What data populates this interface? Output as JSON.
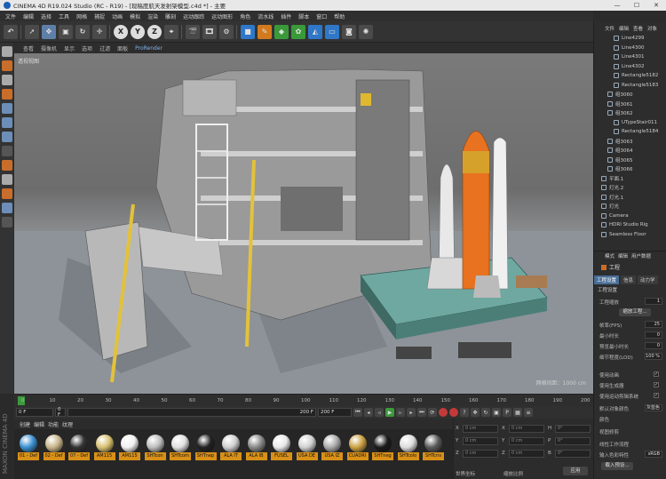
{
  "window": {
    "title": "CINEMA 4D R19.024 Studio (RC - R19) - [现稿度航天发射架模型.c4d *] - 主要",
    "controls": [
      "—",
      "☐",
      "✕"
    ]
  },
  "menu": [
    "文件",
    "编辑",
    "选择",
    "工具",
    "网格",
    "捕捉",
    "动画",
    "模拟",
    "渲染",
    "雕刻",
    "运动跟踪",
    "运动图形",
    "角色",
    "流水线",
    "插件",
    "脚本",
    "窗口",
    "帮助"
  ],
  "toolbar": {
    "axis_buttons": [
      "X",
      "Y",
      "Z"
    ]
  },
  "viewport_menu": [
    "查看",
    "摄像机",
    "显示",
    "选项",
    "过滤",
    "面板",
    "ProRender"
  ],
  "viewport": {
    "label": "透视视图",
    "grid_info": "网格间距：1000 cm"
  },
  "timeline": {
    "ticks": [
      "0",
      "10",
      "20",
      "30",
      "40",
      "50",
      "60",
      "70",
      "80",
      "90",
      "100",
      "110",
      "120",
      "130",
      "140",
      "150",
      "160",
      "170",
      "180",
      "190",
      "200"
    ]
  },
  "playback": {
    "current_frame": "0 F",
    "start_frame": "0 F",
    "end_frame": "200 F",
    "max_frame": "200 F"
  },
  "material_manager": {
    "menu": [
      "创建",
      "编辑",
      "功能",
      "纹理"
    ],
    "materials": [
      {
        "label": "01 - Def",
        "color": "#3a8fd0"
      },
      {
        "label": "02 - Def",
        "color": "#c8b48a"
      },
      {
        "label": "07 - Def",
        "color": "#333333"
      },
      {
        "label": "AM115",
        "color": "#d8c070"
      },
      {
        "label": "AM115",
        "color": "#f0f0f0"
      },
      {
        "label": "SHTcon",
        "color": "#bdbdbd"
      },
      {
        "label": "SHTcom",
        "color": "#e0e0e0"
      },
      {
        "label": "SHTnep",
        "color": "#222222"
      },
      {
        "label": "ALA IT",
        "color": "#cfcfcf"
      },
      {
        "label": "ALA IB",
        "color": "#888888"
      },
      {
        "label": "FUSEL",
        "color": "#e8e8e8"
      },
      {
        "label": "USA DE",
        "color": "#d0d0d0"
      },
      {
        "label": "USA IZ",
        "color": "#aaaaaa"
      },
      {
        "label": "CUADRI",
        "color": "#caa040"
      },
      {
        "label": "SHTneg",
        "color": "#1a1a1a"
      },
      {
        "label": "SHTcolo",
        "color": "#dddddd"
      },
      {
        "label": "SHTcris",
        "color": "#5a5a5a"
      }
    ]
  },
  "coordinates": {
    "rows": [
      {
        "axis": "X",
        "pos": "0 cm",
        "axis2": "X",
        "size": "0 cm",
        "axis3": "H",
        "rot": "0°"
      },
      {
        "axis": "Y",
        "pos": "0 cm",
        "axis2": "Y",
        "size": "0 cm",
        "axis3": "P",
        "rot": "0°"
      },
      {
        "axis": "Z",
        "pos": "0 cm",
        "axis2": "Z",
        "size": "0 cm",
        "axis3": "B",
        "rot": "0°"
      }
    ],
    "mode_left": "世界坐标",
    "mode_right": "缩放比例",
    "apply_label": "应用"
  },
  "object_manager": {
    "menu": [
      "文件",
      "编辑",
      "查看",
      "对象"
    ],
    "items": [
      {
        "name": "Line4299",
        "indent": 2
      },
      {
        "name": "Line4300",
        "indent": 2
      },
      {
        "name": "Line4301",
        "indent": 2
      },
      {
        "name": "Line4302",
        "indent": 2
      },
      {
        "name": "Rectangle5182",
        "indent": 2
      },
      {
        "name": "Rectangle5183",
        "indent": 2
      },
      {
        "name": "组3060",
        "indent": 1
      },
      {
        "name": "组3061",
        "indent": 1
      },
      {
        "name": "组3062",
        "indent": 1
      },
      {
        "name": "UTypeStair011",
        "indent": 2
      },
      {
        "name": "Rectangle5184",
        "indent": 2
      },
      {
        "name": "组3063",
        "indent": 1
      },
      {
        "name": "组3064",
        "indent": 1
      },
      {
        "name": "组3065",
        "indent": 1
      },
      {
        "name": "组3066",
        "indent": 1
      },
      {
        "name": "平面.1",
        "indent": 0
      },
      {
        "name": "灯光.2",
        "indent": 0
      },
      {
        "name": "灯光.1",
        "indent": 0
      },
      {
        "name": "灯光",
        "indent": 0
      },
      {
        "name": "Camera",
        "indent": 0
      },
      {
        "name": "HDRI Studio Rig",
        "indent": 0
      },
      {
        "name": "Seamless Floor",
        "indent": 0
      }
    ]
  },
  "attribute_manager": {
    "menu": [
      "模式",
      "编辑",
      "用户数据"
    ],
    "title": "工程",
    "tabs": [
      {
        "label": "工程设置",
        "active": true
      },
      {
        "label": "信息",
        "active": false
      },
      {
        "label": "动力学",
        "active": false
      }
    ],
    "section": "工程设置",
    "fields": [
      {
        "label": "工程缩放",
        "value": "1"
      },
      {
        "label": "帧率(FPS)",
        "value": "25"
      },
      {
        "label": "最小时长",
        "value": "0"
      },
      {
        "label": "预览最小时长",
        "value": "0"
      },
      {
        "label": "细节程度(LOD)",
        "value": "100 %"
      }
    ],
    "scale_button": "缩放工程...",
    "checks": [
      {
        "label": "使用动画",
        "checked": true
      },
      {
        "label": "使用生成器",
        "checked": true
      },
      {
        "label": "使用运动剪辑系统",
        "checked": true
      }
    ],
    "default_color_label": "默认对象颜色",
    "default_color_value": "灰蓝色",
    "color_label": "颜色",
    "view_clip_label": "视图修剪",
    "linear_label": "线性工作流程",
    "input_color_label": "输入色彩特性",
    "input_color_value": "sRGB",
    "load_preset": "载入预设..."
  },
  "brand": "MAXON CINEMA 4D"
}
